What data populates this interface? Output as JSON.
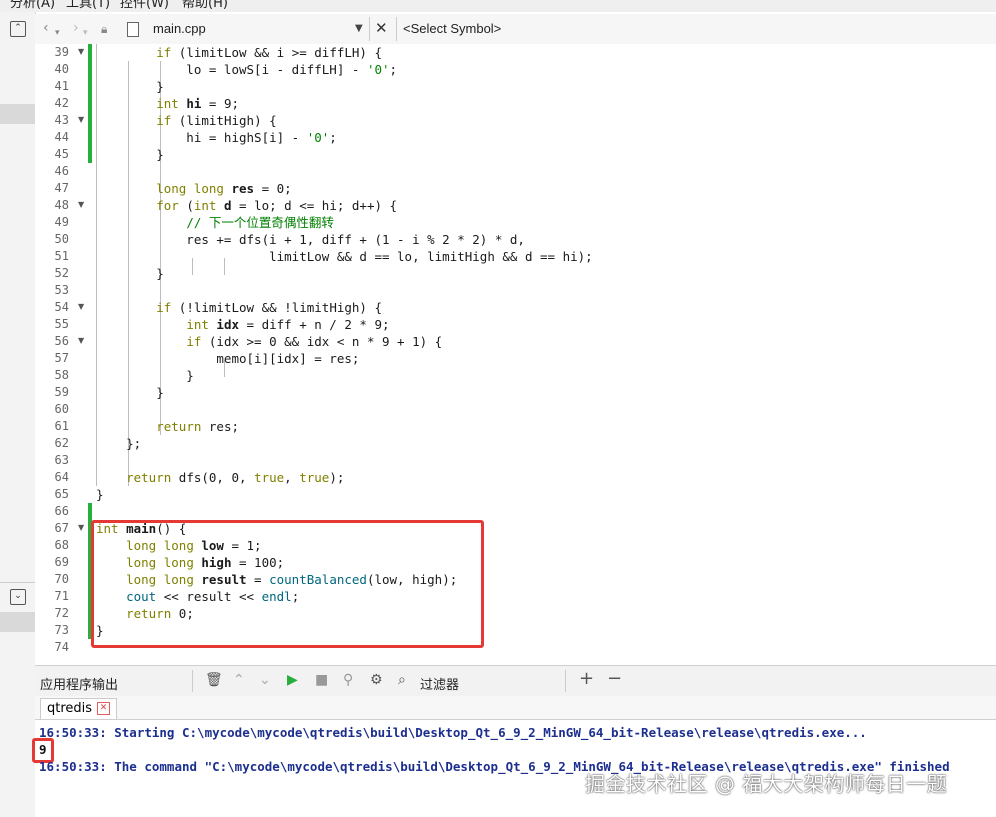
{
  "menu": {
    "analyze": "分析(A)",
    "tools": "工具(T)",
    "controls": "控件(W)",
    "help": "帮助(H)"
  },
  "editor_tab": {
    "filename": "main.cpp",
    "symbol_placeholder": "<Select Symbol>"
  },
  "line_numbers": [
    "39",
    "40",
    "41",
    "42",
    "43",
    "44",
    "45",
    "46",
    "47",
    "48",
    "49",
    "50",
    "51",
    "52",
    "53",
    "54",
    "55",
    "56",
    "57",
    "58",
    "59",
    "60",
    "61",
    "62",
    "63",
    "64",
    "65",
    "66",
    "67",
    "68",
    "69",
    "70",
    "71",
    "72",
    "73",
    "74"
  ],
  "output_panel": {
    "title": "应用程序输出",
    "filter_label": "过滤器",
    "tab_label": "qtredis"
  },
  "output_lines": {
    "line1": "16:50:33: Starting C:\\mycode\\mycode\\qtredis\\build\\Desktop_Qt_6_9_2_MinGW_64_bit-Release\\release\\qtredis.exe...",
    "line2": "9",
    "line3": "16:50:33: The command \"C:\\mycode\\mycode\\qtredis\\build\\Desktop_Qt_6_9_2_MinGW_64_bit-Release\\release\\qtredis.exe\" finished"
  },
  "watermark": "掘金技术社区 @ 福大大架构师每日一题",
  "colors": {
    "highlight_box": "#e53935",
    "change_bar": "#27ae3c",
    "keyword": "#808000",
    "function": "#00677c",
    "string": "#008000",
    "output_text": "#1c2f8f"
  }
}
